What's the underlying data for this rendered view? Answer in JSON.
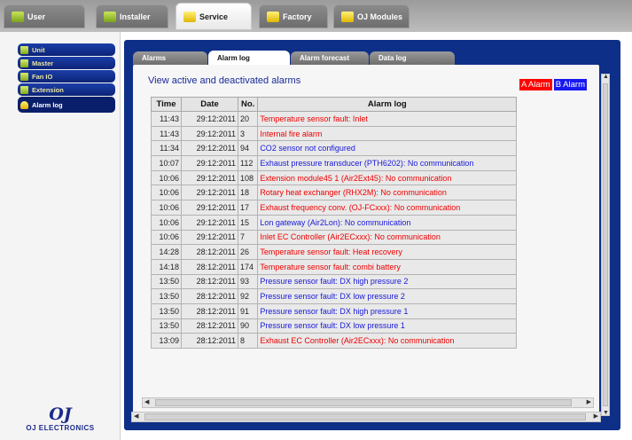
{
  "top_tabs": [
    {
      "label": "User",
      "active": false,
      "icon": "user-icon"
    },
    {
      "label": "Installer",
      "active": false,
      "icon": "installer-icon"
    },
    {
      "label": "Service",
      "active": true,
      "icon": "service-icon"
    },
    {
      "label": "Factory",
      "active": false,
      "icon": "factory-icon"
    },
    {
      "label": "OJ Modules",
      "active": false,
      "icon": "modules-icon"
    }
  ],
  "sidebar": {
    "items": [
      {
        "label": "Unit",
        "active": false
      },
      {
        "label": "Master",
        "active": false
      },
      {
        "label": "Fan IO",
        "active": false
      },
      {
        "label": "Extension",
        "active": false
      },
      {
        "label": "Alarm log",
        "active": true
      }
    ],
    "logo_text": "OJ ELECTRONICS",
    "logo_mark": "OJ"
  },
  "sub_tabs": [
    {
      "label": "Alarms",
      "active": false
    },
    {
      "label": "Alarm log",
      "active": true
    },
    {
      "label": "Alarm forecast",
      "active": false
    },
    {
      "label": "Data log",
      "active": false
    }
  ],
  "content": {
    "heading": "View active and deactivated alarms",
    "legend_a": "A Alarm",
    "legend_b": "B Alarm",
    "colors": {
      "a_alarm": "#ee0000",
      "b_alarm": "#1818d8",
      "panel": "#0d2f88"
    }
  },
  "table": {
    "headers": [
      "Time",
      "Date",
      "No.",
      "Alarm log"
    ],
    "rows": [
      {
        "time": "11:43",
        "date": "29:12:2011",
        "no": "20",
        "msg": "Temperature sensor fault: Inlet",
        "cls": "A"
      },
      {
        "time": "11:43",
        "date": "29:12:2011",
        "no": "3",
        "msg": "Internal fire alarm",
        "cls": "A"
      },
      {
        "time": "11:34",
        "date": "29:12:2011",
        "no": "94",
        "msg": "CO2 sensor not configured",
        "cls": "B"
      },
      {
        "time": "10:07",
        "date": "29:12:2011",
        "no": "112",
        "msg": "Exhaust pressure transducer (PTH6202): No communication",
        "cls": "B"
      },
      {
        "time": "10:06",
        "date": "29:12:2011",
        "no": "108",
        "msg": "Extension module45 1 (Air2Ext45): No communication",
        "cls": "A"
      },
      {
        "time": "10:06",
        "date": "29:12:2011",
        "no": "18",
        "msg": "Rotary heat exchanger (RHX2M): No communication",
        "cls": "A"
      },
      {
        "time": "10:06",
        "date": "29:12:2011",
        "no": "17",
        "msg": "Exhaust frequency conv. (OJ-FCxxx): No communication",
        "cls": "A"
      },
      {
        "time": "10:06",
        "date": "29:12:2011",
        "no": "15",
        "msg": "Lon gateway (Air2Lon): No communication",
        "cls": "B"
      },
      {
        "time": "10:06",
        "date": "29:12:2011",
        "no": "7",
        "msg": "Inlet EC Controller (Air2ECxxx): No communication",
        "cls": "A"
      },
      {
        "time": "14:28",
        "date": "28:12:2011",
        "no": "26",
        "msg": "Temperature sensor fault: Heat recovery",
        "cls": "A"
      },
      {
        "time": "14:18",
        "date": "28:12:2011",
        "no": "174",
        "msg": "Temperature sensor fault: combi battery",
        "cls": "A"
      },
      {
        "time": "13:50",
        "date": "28:12:2011",
        "no": "93",
        "msg": "Pressure sensor fault: DX high pressure 2",
        "cls": "B"
      },
      {
        "time": "13:50",
        "date": "28:12:2011",
        "no": "92",
        "msg": "Pressure sensor fault: DX low pressure 2",
        "cls": "B"
      },
      {
        "time": "13:50",
        "date": "28:12:2011",
        "no": "91",
        "msg": "Pressure sensor fault: DX high pressure 1",
        "cls": "B"
      },
      {
        "time": "13:50",
        "date": "28:12:2011",
        "no": "90",
        "msg": "Pressure sensor fault: DX low pressure 1",
        "cls": "B"
      },
      {
        "time": "13:09",
        "date": "28:12:2011",
        "no": "8",
        "msg": "Exhaust EC Controller (Air2ECxxx): No communication",
        "cls": "A"
      }
    ]
  }
}
